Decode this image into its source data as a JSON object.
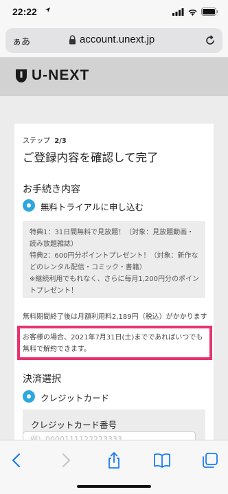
{
  "status_bar": {
    "time": "22:22"
  },
  "browser": {
    "aa_label": "ぁあ",
    "url": "account.unext.jp"
  },
  "brand": {
    "logo_text": "U-NEXT"
  },
  "form": {
    "step_label": "ステップ",
    "step_value": "2/3",
    "title": "ご登録内容を確認して完了",
    "procedure_heading": "お手続き内容",
    "trial_option_label": "無料トライアルに申し込む",
    "benefits": [
      "特典1：31日間無料で見放題！（対象：見放題動画・",
      "読み放題雑誌）",
      "特典2：600円分ポイントプレゼント！（対象：新作な",
      "どのレンタル配信・コミック・書籍）",
      "※継続利用でもれなく、さらに毎月1,200円分のポイン",
      "トプレゼント！"
    ],
    "fee_note": "無料期間終了後は月額利用料2,189円（税込）がかかります",
    "cancel_note_line1": "お客様の場合、2021年7月31日(土)までであればいつでも",
    "cancel_note_line2": "無料で解約できます。",
    "payment_heading": "決済選択",
    "payment_option_label": "クレジットカード",
    "card_number_label": "クレジットカード番号",
    "card_number_placeholder": "例）0000111122223333"
  },
  "colors": {
    "accent_radio": "#2ea7e0",
    "highlight_frame": "#e6336e",
    "brand_band": "#d2d2d2"
  },
  "icons": {
    "status": [
      "location-arrow-icon",
      "cellular-signal-icon",
      "wifi-icon",
      "battery-icon"
    ],
    "url_bar": [
      "lock-icon",
      "reload-icon"
    ],
    "toolbar": [
      "back-icon",
      "forward-icon",
      "share-icon",
      "bookmarks-icon",
      "tabs-icon"
    ]
  }
}
